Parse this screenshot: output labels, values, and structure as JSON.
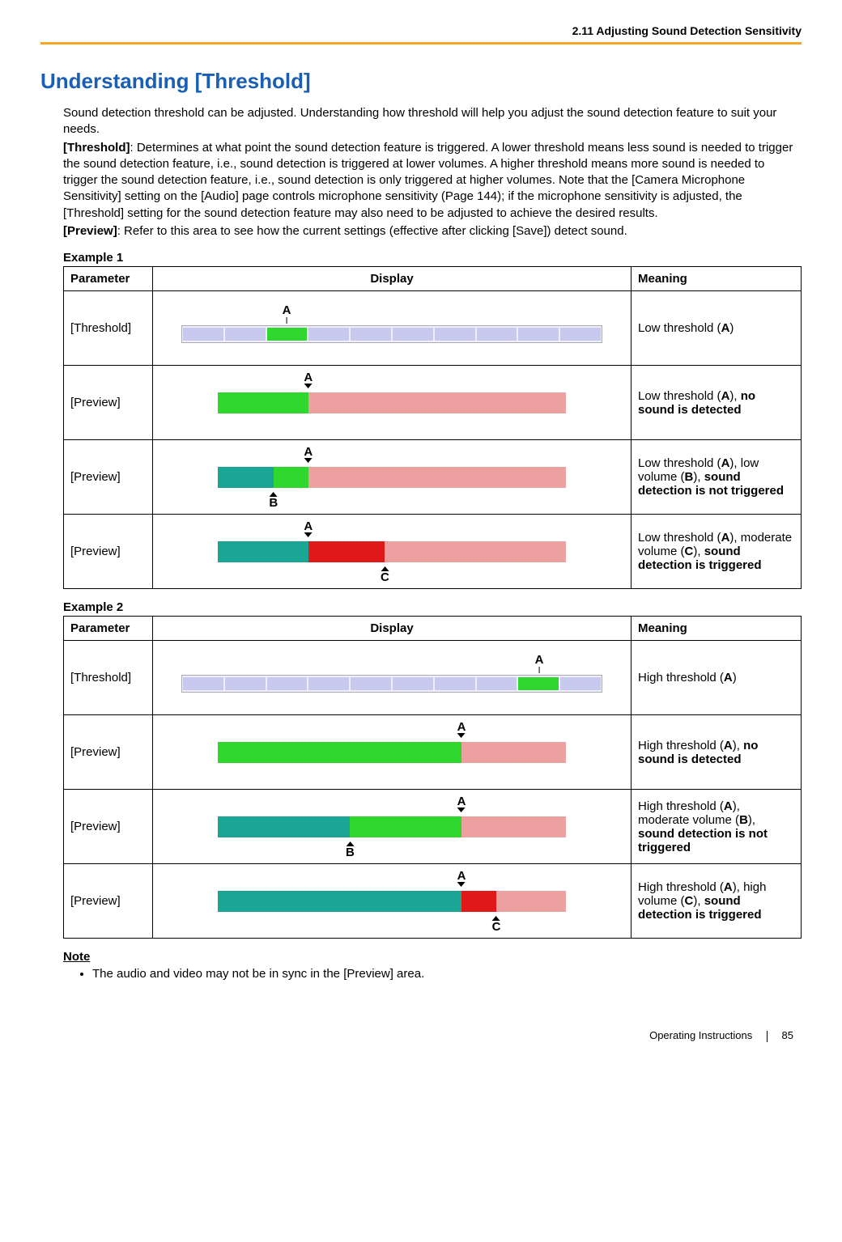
{
  "header_section": "2.11 Adjusting Sound Detection Sensitivity",
  "title": "Understanding [Threshold]",
  "intro": "Sound detection threshold can be adjusted. Understanding how threshold will help you adjust the sound detection feature to suit your needs.",
  "threshold_label": "[Threshold]",
  "threshold_text": ": Determines at what point the sound detection feature is triggered. A lower threshold means less sound is needed to trigger the sound detection feature, i.e., sound detection is triggered at lower volumes. A higher threshold means more sound is needed to trigger the sound detection feature, i.e., sound detection is only triggered at higher volumes. Note that the [Camera Microphone Sensitivity] setting on the [Audio] page controls microphone sensitivity (Page 144); if the microphone sensitivity is adjusted, the [Threshold] setting for the sound detection feature may also need to be adjusted to achieve the desired results.",
  "preview_label": "[Preview]",
  "preview_text": ": Refer to this area to see how the current settings (effective after clicking [Save]) detect sound.",
  "cols": {
    "parameter": "Parameter",
    "display": "Display",
    "meaning": "Meaning"
  },
  "labels": {
    "A": "A",
    "B": "B",
    "C": "C"
  },
  "ex1": {
    "heading": "Example 1",
    "rows": [
      {
        "param": "[Threshold]",
        "meaning_html": "Low threshold (<b>A</b>)"
      },
      {
        "param": "[Preview]",
        "meaning_html": "Low threshold (<b>A</b>), <b>no sound is detected</b>"
      },
      {
        "param": "[Preview]",
        "meaning_html": "Low threshold (<b>A</b>), low volume (<b>B</b>), <b>sound detection is not triggered</b>"
      },
      {
        "param": "[Preview]",
        "meaning_html": "Low threshold (<b>A</b>), moderate volume (<b>C</b>), <b>sound detection is triggered</b>"
      }
    ]
  },
  "ex2": {
    "heading": "Example 2",
    "rows": [
      {
        "param": "[Threshold]",
        "meaning_html": "High threshold (<b>A</b>)"
      },
      {
        "param": "[Preview]",
        "meaning_html": "High threshold (<b>A</b>), <b>no sound is detected</b>"
      },
      {
        "param": "[Preview]",
        "meaning_html": "High threshold (<b>A</b>), moderate volume (<b>B</b>), <b>sound detection is not triggered</b>"
      },
      {
        "param": "[Preview]",
        "meaning_html": "High threshold (<b>A</b>), high volume (<b>C</b>), <b>sound detection is triggered</b>"
      }
    ]
  },
  "note_heading": "Note",
  "note_items": [
    "The audio and video may not be in sync in the [Preview] area."
  ],
  "footer": {
    "doc": "Operating Instructions",
    "page": "85"
  },
  "chart_data": {
    "type": "table",
    "description": "Two example tables illustrating threshold slider position and preview meter fill vs detection state.",
    "example1": {
      "threshold_slot_index": 2,
      "threshold_slots_total": 10,
      "previews": [
        {
          "A_pct": 26,
          "fill_pct": 0,
          "fill_color": null,
          "detected": false
        },
        {
          "A_pct": 26,
          "B_pct": 16,
          "fill_pct": 16,
          "fill_color": "teal",
          "detected": false
        },
        {
          "A_pct": 26,
          "C_pct": 48,
          "fill_pct": 48,
          "fill_triggered_color": "red",
          "pre_fill_color": "teal",
          "detected": true
        }
      ]
    },
    "example2": {
      "threshold_slot_index": 8,
      "threshold_slots_total": 10,
      "previews": [
        {
          "A_pct": 70,
          "fill_pct": 0,
          "detected": false
        },
        {
          "A_pct": 70,
          "B_pct": 38,
          "fill_pct": 38,
          "fill_color": "teal",
          "detected": false
        },
        {
          "A_pct": 70,
          "C_pct": 80,
          "fill_pct": 80,
          "fill_triggered_color": "red",
          "pre_fill_color": "teal",
          "detected": true
        }
      ]
    }
  }
}
